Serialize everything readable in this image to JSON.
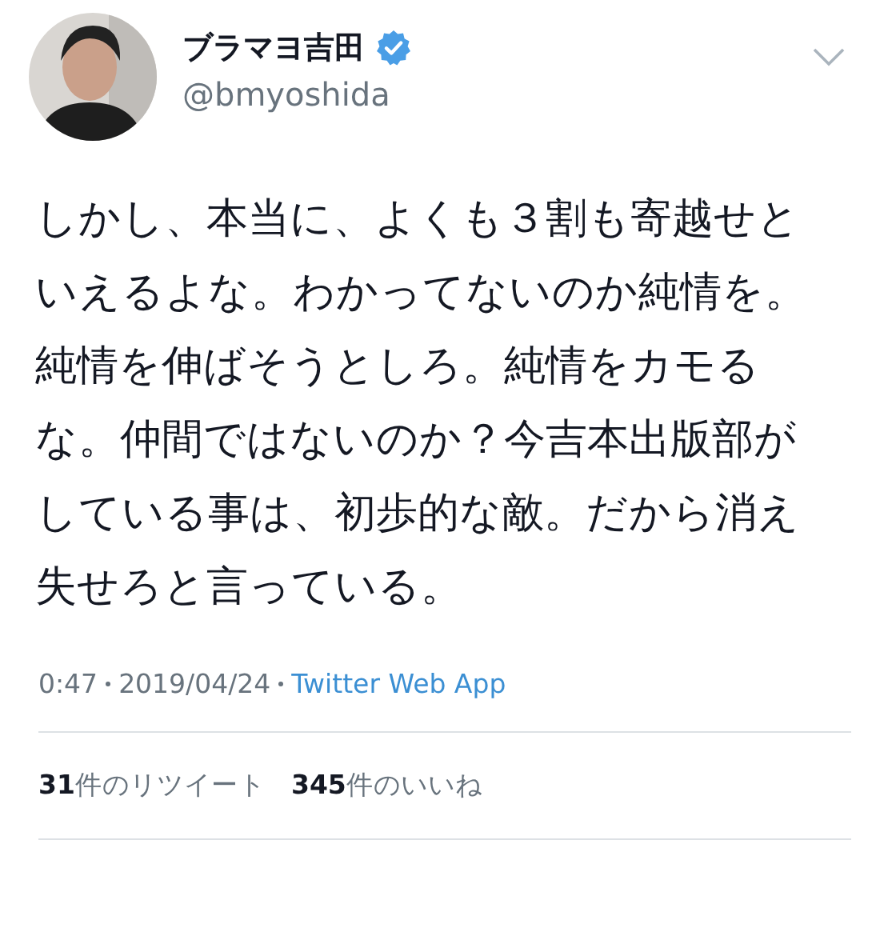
{
  "tweet": {
    "author": {
      "name": "ブラマヨ吉田",
      "handle": "@bmyoshida",
      "verified": true
    },
    "text": "しかし、本当に、よくも３割も寄越せといえるよな。わかってないのか純情を。純情を伸ばそうとしろ。純情をカモるな。仲間ではないのか？今吉本出版部がしている事は、初歩的な敵。だから消え失せろと言っている。",
    "meta": {
      "time": "0:47",
      "date": "2019/04/24",
      "source": "Twitter Web App"
    },
    "stats": [
      {
        "text": "**31**件のリツイート"
      },
      {
        "text": "**345**件のいいね"
      }
    ]
  }
}
